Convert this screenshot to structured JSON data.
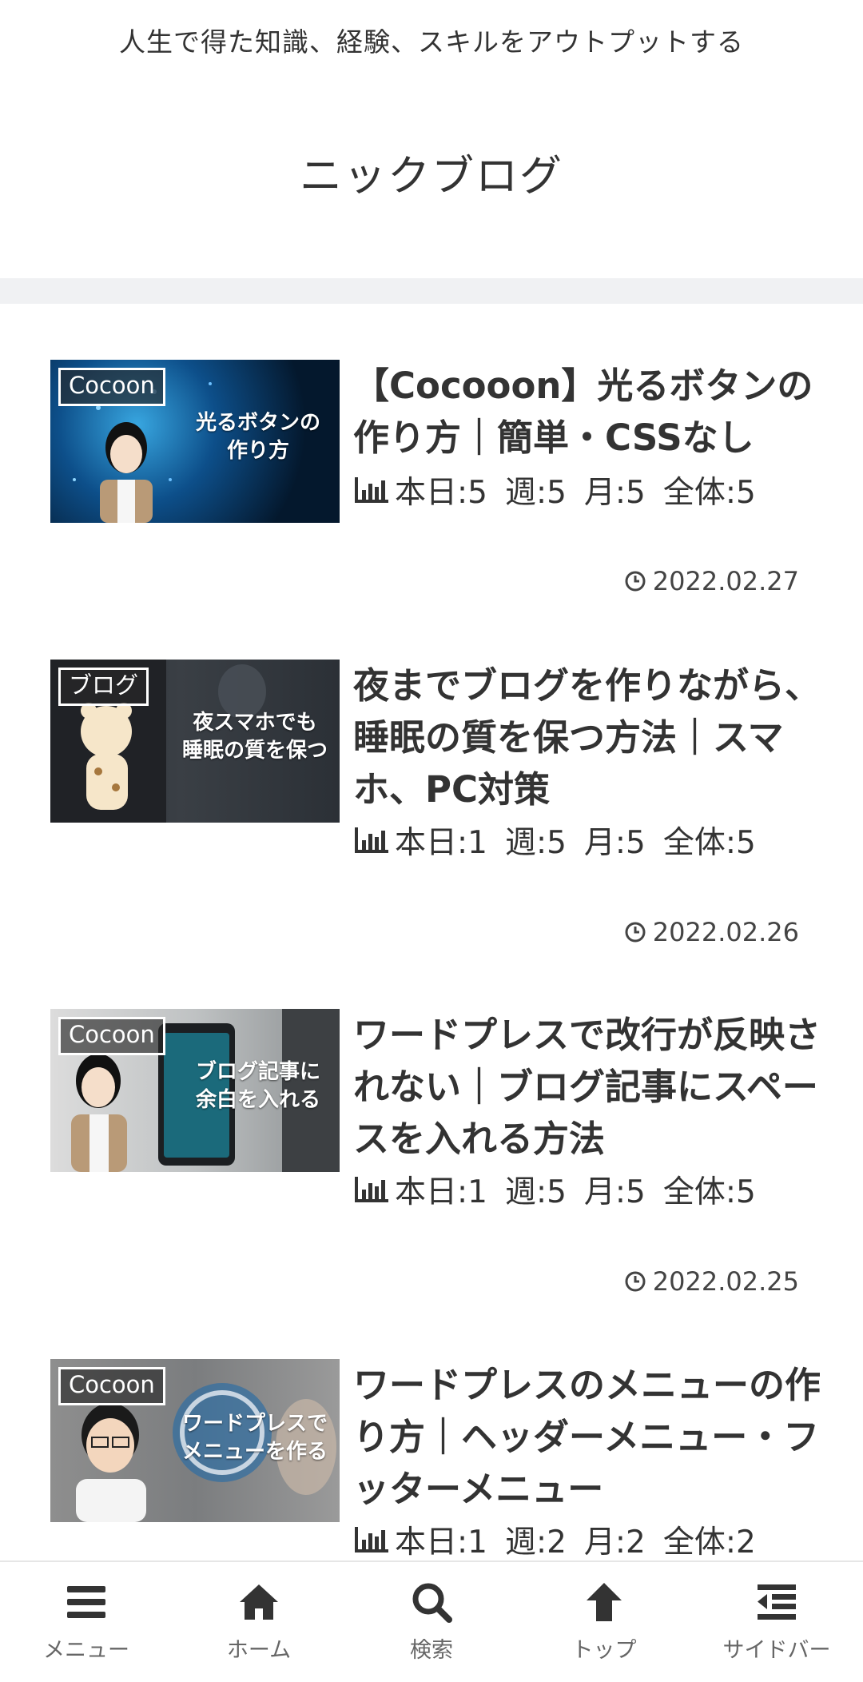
{
  "header": {
    "tagline": "人生で得た知識、経験、スキルをアウトプットする",
    "site_title": "ニックブログ"
  },
  "posts": [
    {
      "category": "Cocoon",
      "thumb_caption": "光るボタンの\n作り方",
      "title": "【Cocooon】光るボタンの作り方｜簡単・CSSなし",
      "views": {
        "today": "本日:5",
        "week": "週:5",
        "month": "月:5",
        "total": "全体:5"
      },
      "date": "2022.02.27"
    },
    {
      "category": "ブログ",
      "thumb_caption": "夜スマホでも\n睡眠の質を保つ",
      "title": "夜までブログを作りながら、睡眠の質を保つ方法｜スマホ、PC対策",
      "views": {
        "today": "本日:1",
        "week": "週:5",
        "month": "月:5",
        "total": "全体:5"
      },
      "date": "2022.02.26"
    },
    {
      "category": "Cocoon",
      "thumb_caption": "ブログ記事に\n余白を入れる",
      "title": "ワードプレスで改行が反映されない｜ブログ記事にスペースを入れる方法",
      "views": {
        "today": "本日:1",
        "week": "週:5",
        "month": "月:5",
        "total": "全体:5"
      },
      "date": "2022.02.25"
    },
    {
      "category": "Cocoon",
      "thumb_caption": "ワードプレスで\nメニューを作る",
      "title": "ワードプレスのメニューの作り方｜ヘッダーメニュー・フッターメニュー",
      "views": {
        "today": "本日:1",
        "week": "週:2",
        "month": "月:2",
        "total": "全体:2"
      },
      "date": ""
    }
  ],
  "footer_nav": [
    {
      "label": "メニュー",
      "icon": "bars-icon"
    },
    {
      "label": "ホーム",
      "icon": "home-icon"
    },
    {
      "label": "検索",
      "icon": "search-icon"
    },
    {
      "label": "トップ",
      "icon": "arrow-up-icon"
    },
    {
      "label": "サイドバー",
      "icon": "sidebar-outdent-icon"
    }
  ],
  "colors": {
    "text": "#333333",
    "band": "#f0f1f3",
    "footer_label": "#666666"
  }
}
